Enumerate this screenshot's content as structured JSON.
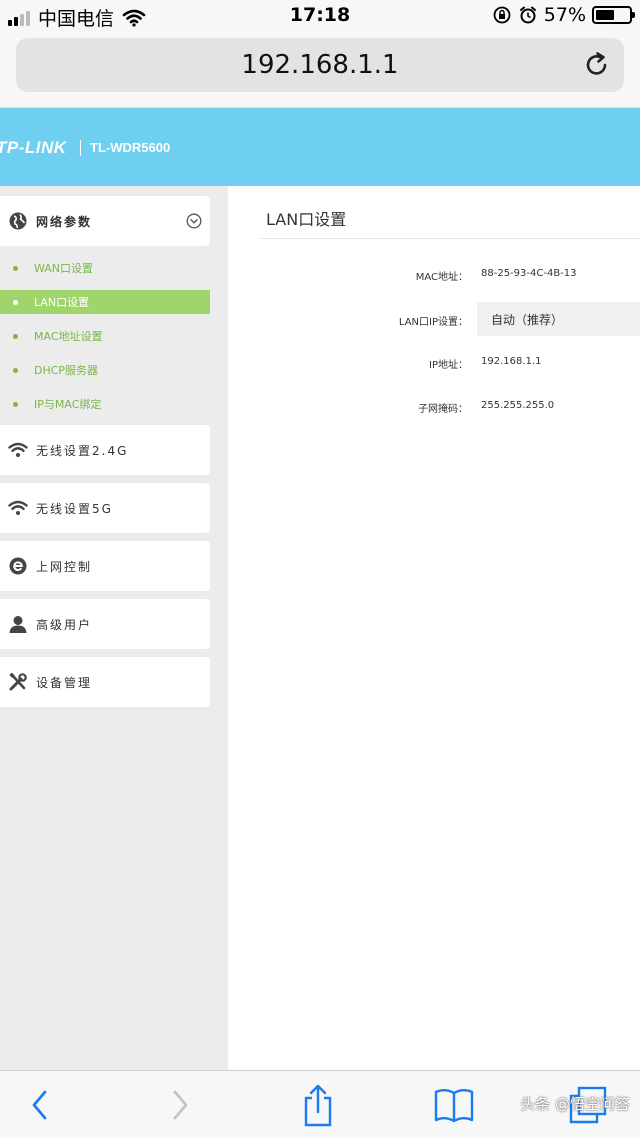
{
  "status_bar": {
    "carrier": "中国电信",
    "time": "17:18",
    "battery": "57%",
    "battery_level": 0.57
  },
  "browser": {
    "url": "192.168.1.1"
  },
  "header": {
    "brand": "TP-LINK",
    "model": "TL-WDR5600"
  },
  "sidebar": {
    "network_group": {
      "label": "网络参数",
      "items": [
        {
          "label": "WAN口设置"
        },
        {
          "label": "LAN口设置",
          "active": true
        },
        {
          "label": "MAC地址设置"
        },
        {
          "label": "DHCP服务器"
        },
        {
          "label": "IP与MAC绑定"
        }
      ]
    },
    "menus": [
      {
        "label": "无线设置2.4G",
        "icon": "wifi-icon"
      },
      {
        "label": "无线设置5G",
        "icon": "wifi-icon"
      },
      {
        "label": "上网控制",
        "icon": "internet-e-icon"
      },
      {
        "label": "高级用户",
        "icon": "user-icon"
      },
      {
        "label": "设备管理",
        "icon": "tools-icon"
      }
    ]
  },
  "main": {
    "title": "LAN口设置",
    "fields": {
      "mac": {
        "label": "MAC地址：",
        "value": "88-25-93-4C-4B-13"
      },
      "lan_ip_mode": {
        "label": "LAN口IP设置：",
        "value": "自动（推荐）"
      },
      "ip": {
        "label": "IP地址：",
        "value": "192.168.1.1"
      },
      "subnet": {
        "label": "子网掩码：",
        "value": "255.255.255.0"
      }
    }
  },
  "watermark": "头条 @悟空问答",
  "colors": {
    "header": "#6ecff1",
    "accent_green": "#7ab648",
    "active_green": "#9fd56b",
    "ios_blue": "#1a7cf0"
  }
}
